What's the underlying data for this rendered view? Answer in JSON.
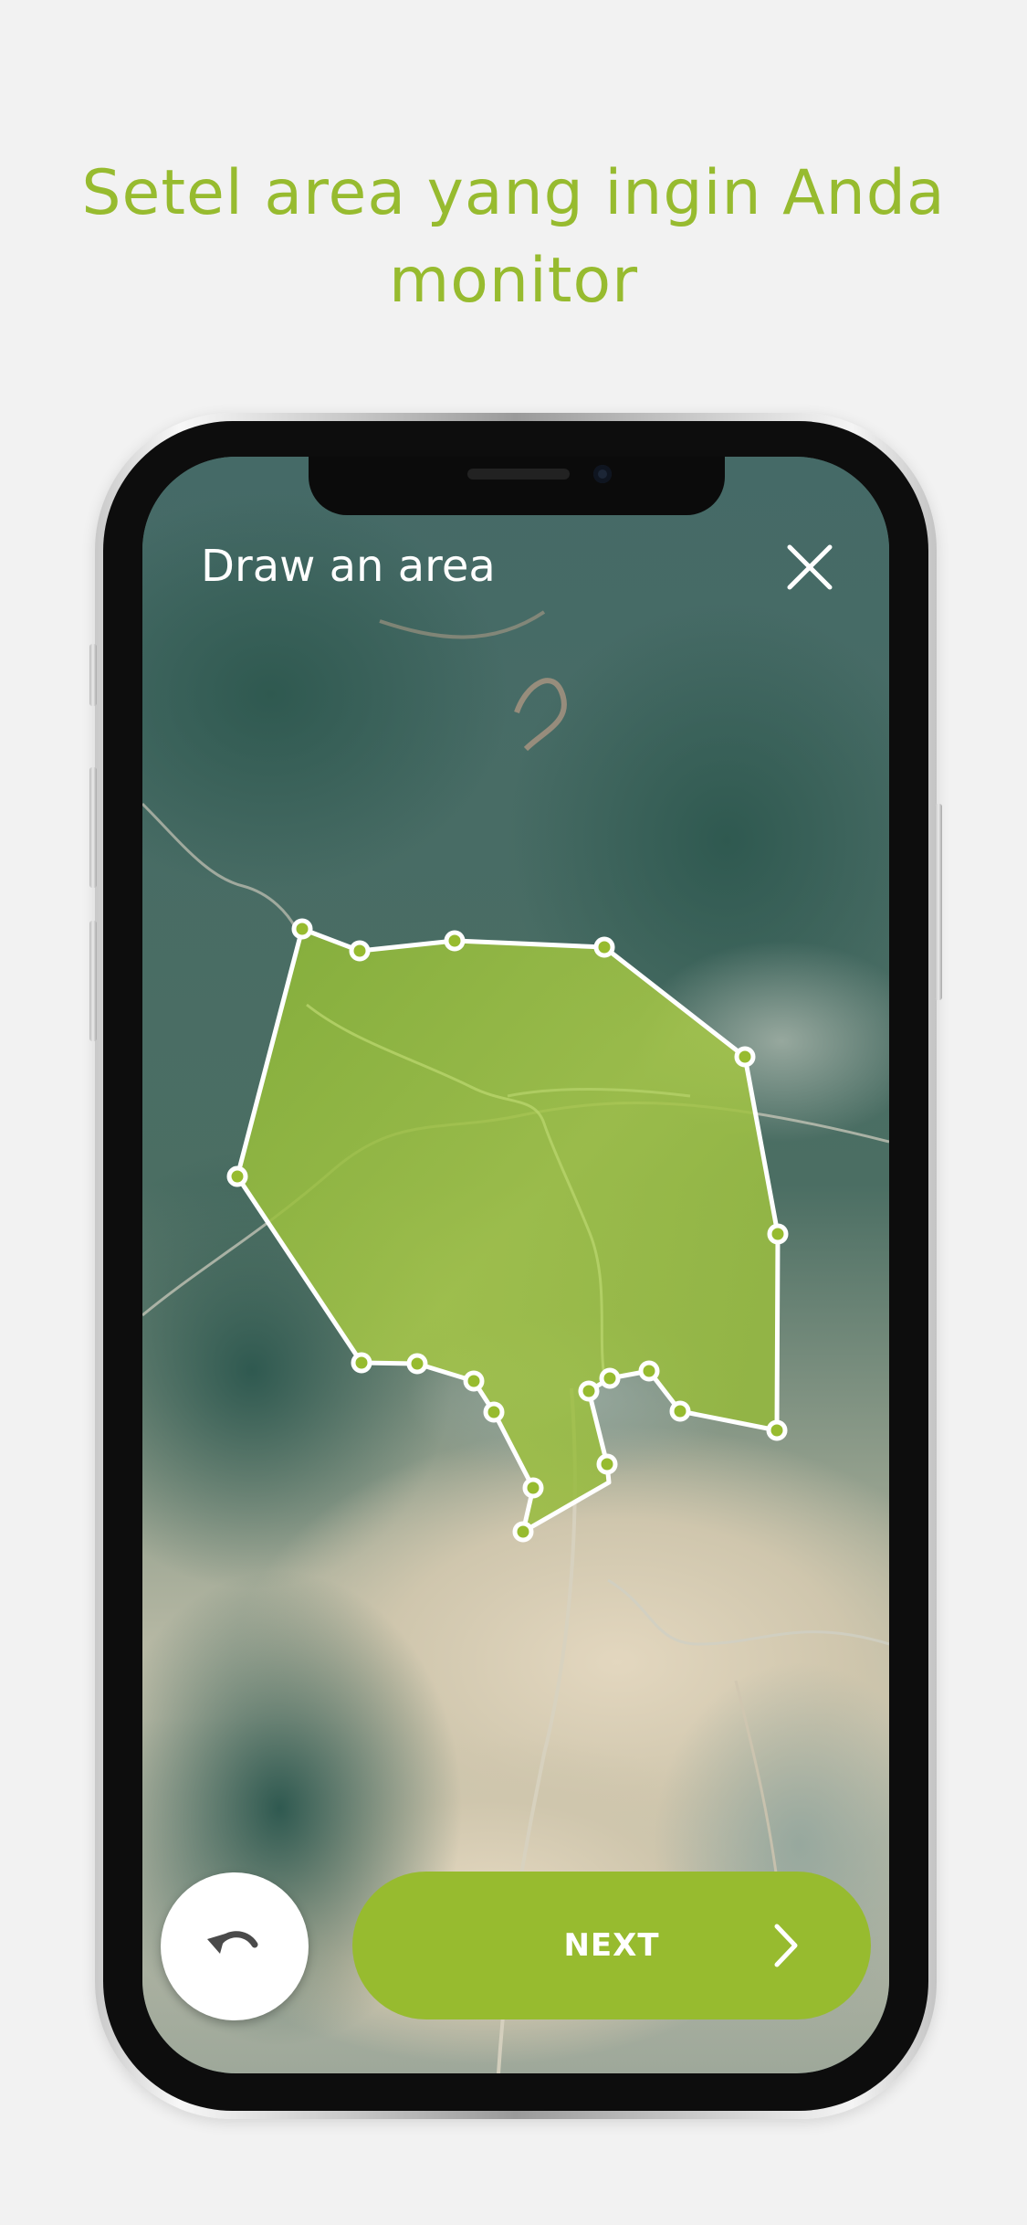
{
  "headline": "Setel area yang ingin Anda monitor",
  "screen": {
    "title": "Draw an area",
    "close_icon": "close-icon",
    "undo_icon": "undo-icon",
    "next_label": "NEXT",
    "next_icon": "chevron-right-icon"
  },
  "colors": {
    "accent": "#97bb2f",
    "background": "#f2f2f2",
    "polygon_fill": "#9cc43a",
    "polygon_stroke": "#ffffff"
  }
}
